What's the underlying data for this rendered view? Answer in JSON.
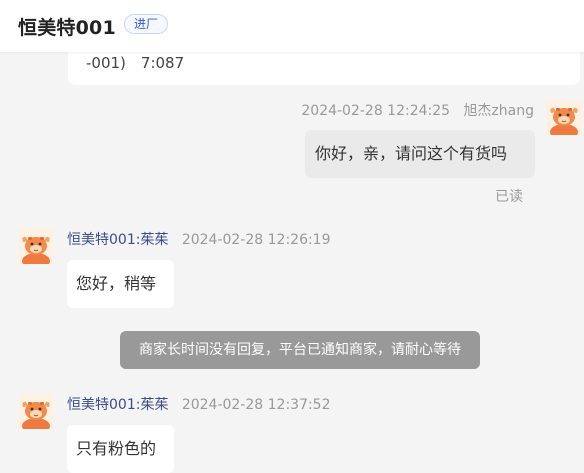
{
  "header": {
    "shop_name": "恒美特001",
    "badge": "进厂"
  },
  "top_card": {
    "text": "-001)　7:087"
  },
  "messages": [
    {
      "side": "right",
      "timestamp": "2024-02-28 12:24:25",
      "sender": "旭杰zhang",
      "text": "你好，亲，请问这个有货吗",
      "status": "已读"
    },
    {
      "side": "left",
      "sender": "恒美特001:茱茱",
      "timestamp": "2024-02-28 12:26:19",
      "text": "您好，稍等"
    },
    {
      "side": "left",
      "sender": "恒美特001:茱茱",
      "timestamp": "2024-02-28 12:37:52",
      "text": "只有粉色的"
    }
  ],
  "system_notice": "商家长时间没有回复，平台已通知商家，请耐心等待",
  "avatar_icon": "cartoon-character-icon",
  "colors": {
    "sender_name": "#3a4b8e",
    "badge_text": "#2e5bd6",
    "notice_bg": "#999999",
    "avatar_accent": "#f07a3a"
  }
}
